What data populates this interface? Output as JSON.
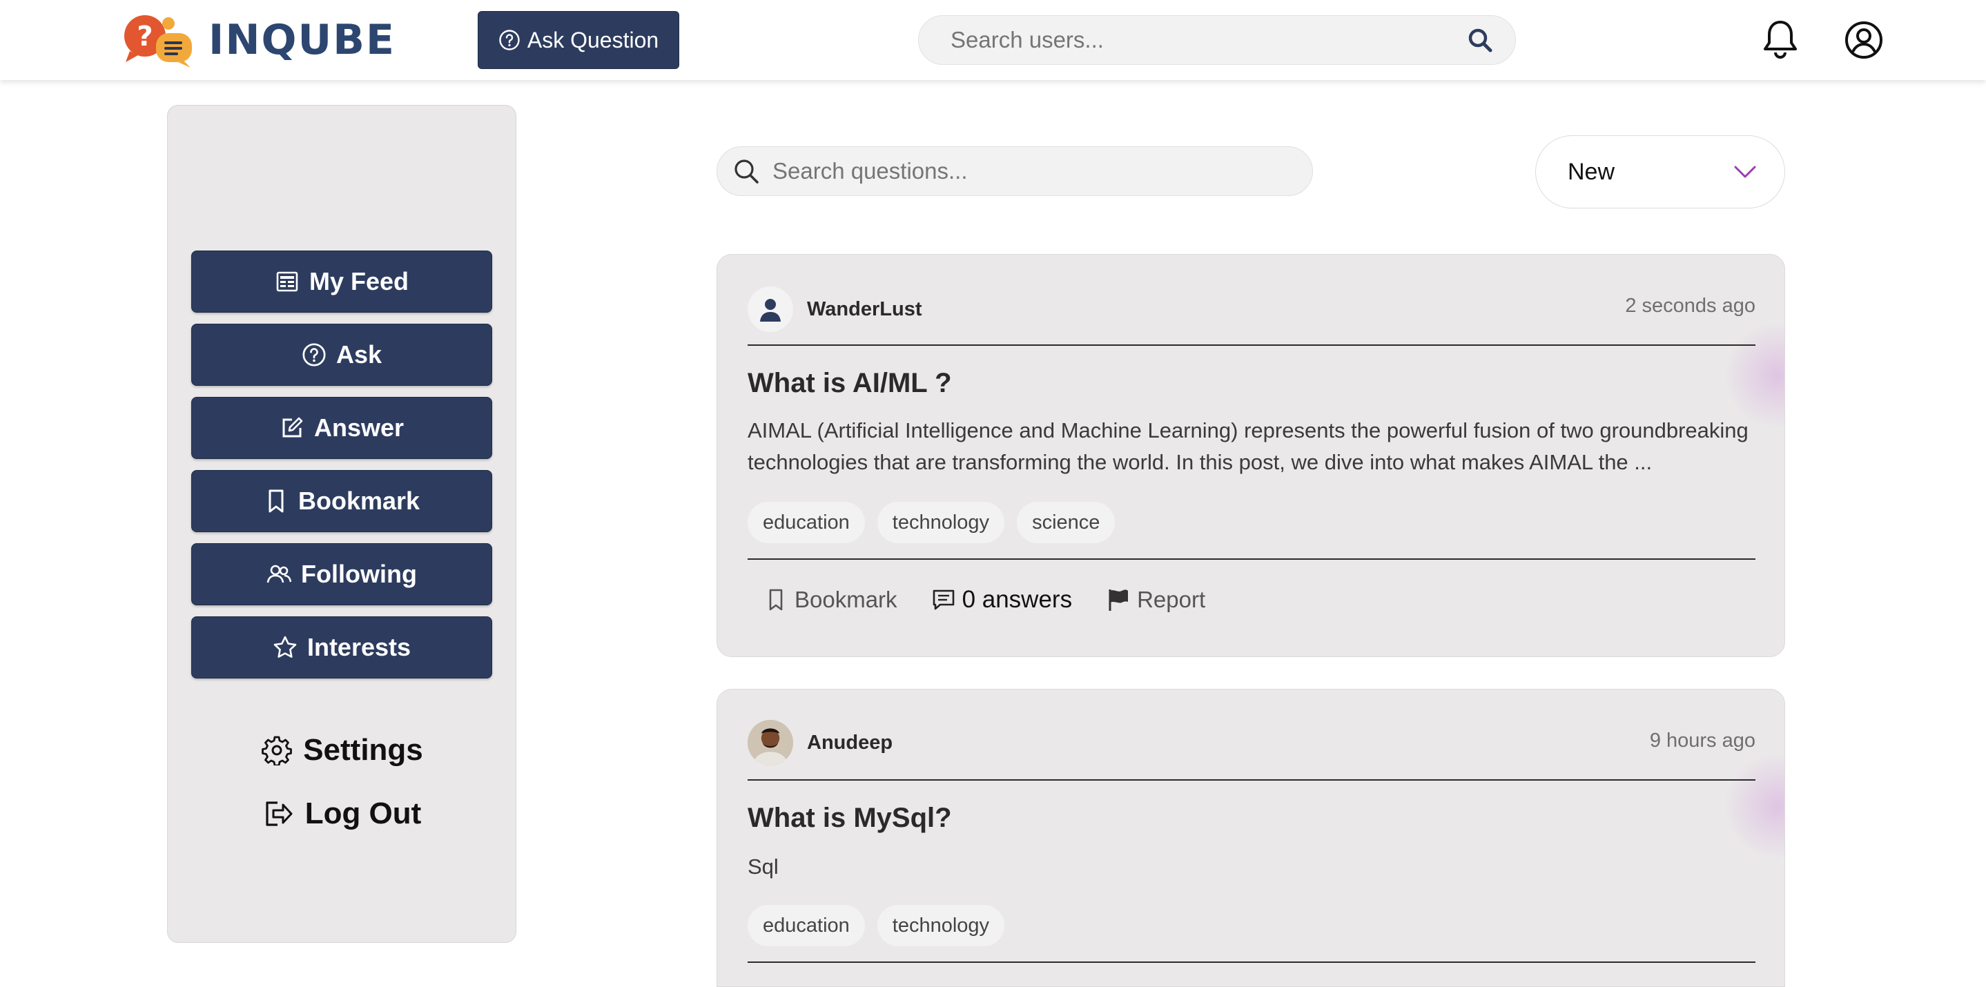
{
  "header": {
    "logo_text": "INQUBE",
    "ask_button_label": "Ask Question",
    "user_search_placeholder": "Search users..."
  },
  "sidebar": {
    "items": [
      {
        "label": "My Feed",
        "icon": "feed-icon"
      },
      {
        "label": "Ask",
        "icon": "question-circle-icon"
      },
      {
        "label": "Answer",
        "icon": "edit-icon"
      },
      {
        "label": "Bookmark",
        "icon": "bookmark-icon"
      },
      {
        "label": "Following",
        "icon": "people-icon"
      },
      {
        "label": "Interests",
        "icon": "star-icon"
      }
    ],
    "settings_label": "Settings",
    "logout_label": "Log Out"
  },
  "main": {
    "question_search_placeholder": "Search questions...",
    "sort_selected": "New",
    "questions": [
      {
        "author": "WanderLust",
        "time": "2 seconds ago",
        "title": "What is AI/ML ?",
        "body": "AIMAL (Artificial Intelligence and Machine Learning) represents the powerful fusion of two groundbreaking technologies that are transforming the world. In this post, we dive into what makes AIMAL the ...",
        "tags": [
          "education",
          "technology",
          "science"
        ],
        "bookmark_label": "Bookmark",
        "answers_label": "0 answers",
        "report_label": "Report"
      },
      {
        "author": "Anudeep",
        "time": "9 hours ago",
        "title": "What is MySql?",
        "body": "Sql",
        "tags": [
          "education",
          "technology"
        ]
      }
    ]
  },
  "colors": {
    "brand_navy": "#2d3c5e",
    "logo_orange": "#e2572f",
    "logo_yellow": "#f2a93b",
    "card_bg": "#eae8e9"
  }
}
